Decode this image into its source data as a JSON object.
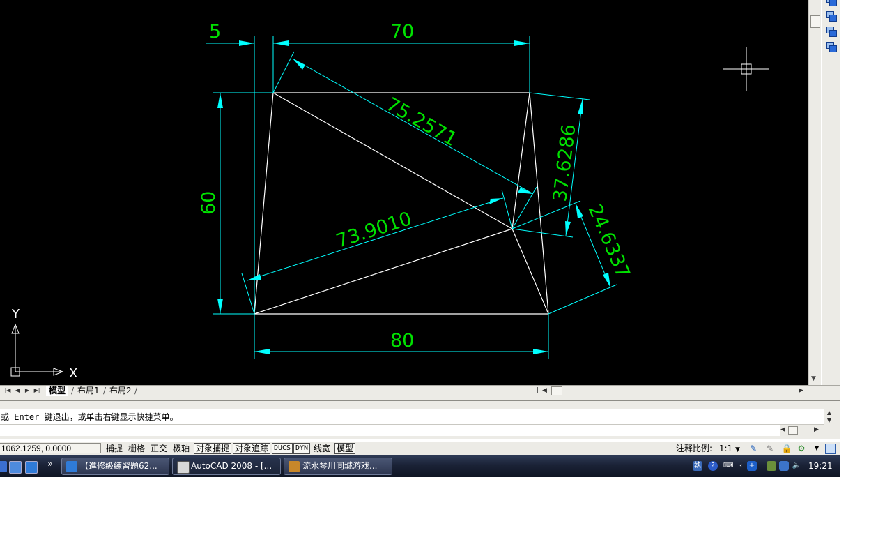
{
  "drawing": {
    "dimensions": {
      "top_left": "5",
      "top_main": "70",
      "left": "60",
      "bottom": "80",
      "diag_long": "75.2571",
      "diag_lower": "73.9010",
      "right_upper": "37.6286",
      "right_lower": "24.6337"
    },
    "ucs": {
      "y_label": "Y",
      "x_label": "X"
    },
    "colors": {
      "background": "#000000",
      "geometry": "#ffffff",
      "dimension_lines": "#00ffff",
      "dimension_text": "#00e000"
    }
  },
  "layout_tabs": {
    "model": "模型",
    "layout1": "布局1",
    "layout2": "布局2"
  },
  "command": {
    "history_line": "或 Enter 键退出，或单击右键显示快捷菜单。"
  },
  "status": {
    "coordinates": "1062.1259, 0.0000",
    "buttons": [
      "捕捉",
      "栅格",
      "正交",
      "极轴",
      "对象捕捉",
      "对象追踪",
      "DUCS",
      "DYN",
      "线宽",
      "模型"
    ],
    "annotation_scale_label": "注释比例:",
    "annotation_scale_value": "1:1"
  },
  "taskbar": {
    "tasks": [
      "【進修級練習題62...",
      "AutoCAD 2008 - [...",
      "流水琴川同城游戏..."
    ],
    "clock": "19:21"
  }
}
